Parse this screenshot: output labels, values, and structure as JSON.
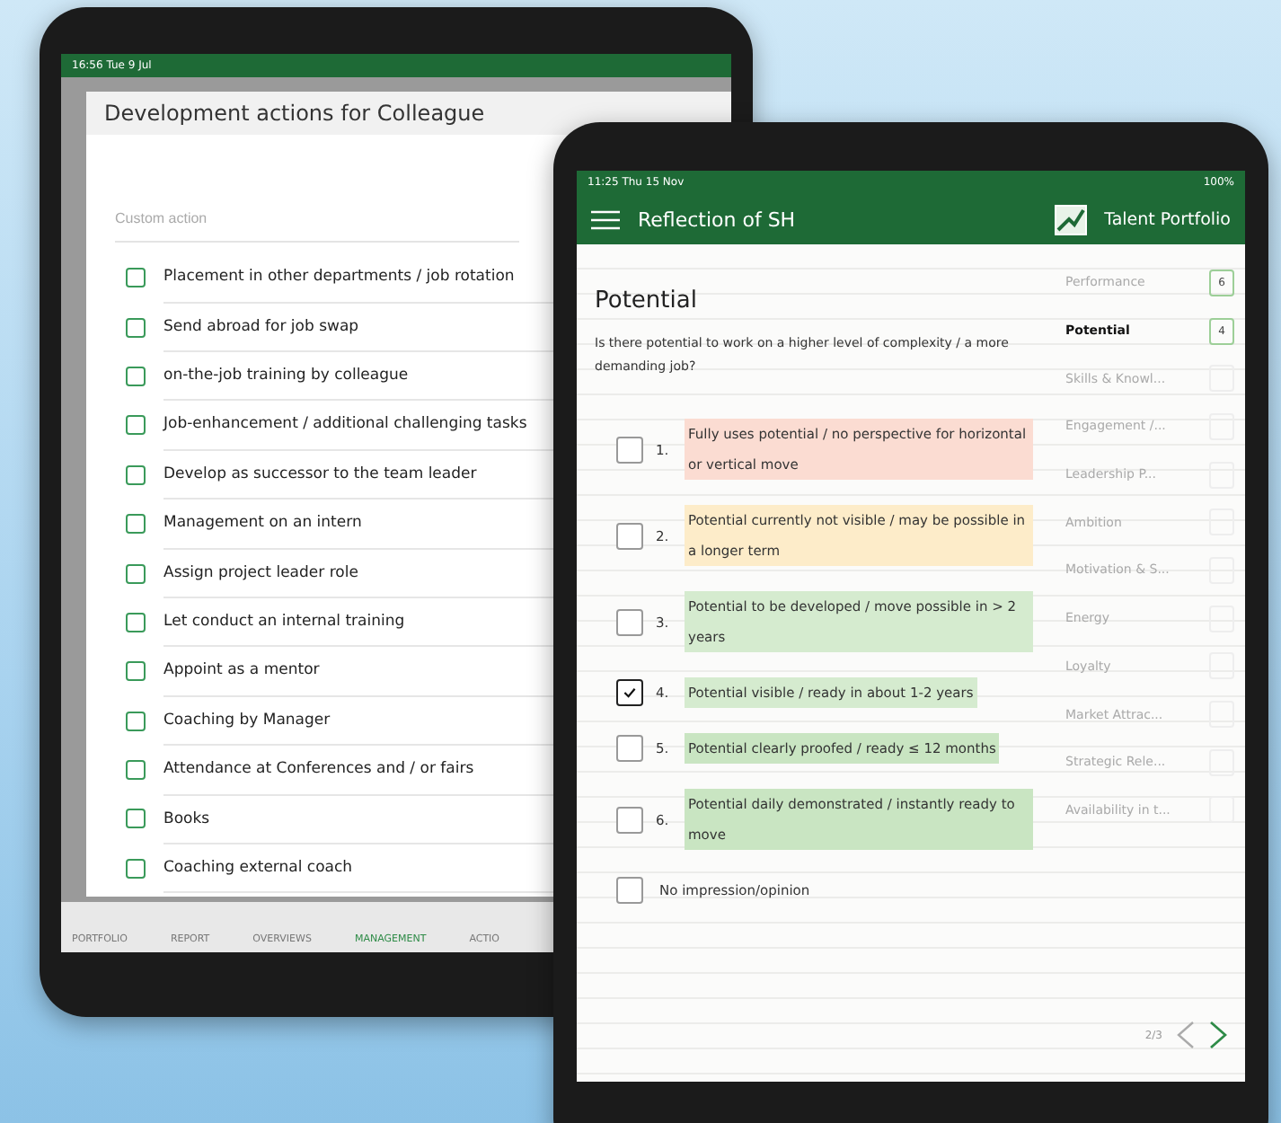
{
  "back_tablet": {
    "status_bar": {
      "time": "16:56 Tue 9 Jul"
    },
    "dialog": {
      "title": "Development actions for Colleague",
      "custom_action": {
        "placeholder": "Custom action"
      },
      "actions": [
        {
          "label": "Placement in other departments / job rotation",
          "checked": false
        },
        {
          "label": "Send abroad for job swap",
          "checked": false
        },
        {
          "label": "on-the-job training by colleague",
          "checked": false
        },
        {
          "label": "Job-enhancement / additional challenging tasks",
          "checked": false
        },
        {
          "label": "Develop as successor to the team leader",
          "checked": false
        },
        {
          "label": "Management on an intern",
          "checked": false
        },
        {
          "label": "Assign project leader role",
          "checked": false
        },
        {
          "label": "Let conduct an internal training",
          "checked": false
        },
        {
          "label": "Appoint as a mentor",
          "checked": false
        },
        {
          "label": "Coaching by Manager",
          "checked": false
        },
        {
          "label": "Attendance at Conferences and / or fairs",
          "checked": false
        },
        {
          "label": "Books",
          "checked": false
        },
        {
          "label": "Coaching external coach",
          "checked": false
        }
      ]
    },
    "tab_bar": [
      {
        "label": "PORTFOLIO",
        "selected": false
      },
      {
        "label": "REPORT",
        "selected": false
      },
      {
        "label": "OVERVIEWS",
        "selected": false
      },
      {
        "label": "MANAGEMENT",
        "selected": true
      },
      {
        "label": "ACTIO",
        "selected": false
      }
    ]
  },
  "front_tablet": {
    "status_bar": {
      "time": "11:25 Thu 15 Nov",
      "battery": "100%"
    },
    "header": {
      "title": "Reflection of SH",
      "brand": "Talent Portfolio"
    },
    "question": {
      "title": "Potential",
      "text": "Is there potential to work on a higher level of complexity / a more demanding job?"
    },
    "options": [
      {
        "number": "1.",
        "label": "Fully uses potential / no perspective for horizontal or vertical move",
        "checked": false,
        "color": "#fbdcd2"
      },
      {
        "number": "2.",
        "label": "Potential currently not visible / may be possible in a longer term",
        "checked": false,
        "color": "#fdecc9"
      },
      {
        "number": "3.",
        "label": "Potential to be developed / move possible in > 2 years",
        "checked": false,
        "color": "#d5ebcf"
      },
      {
        "number": "4.",
        "label": "Potential visible / ready in about 1-2 years",
        "checked": true,
        "color": "#d5ebcf"
      },
      {
        "number": "5.",
        "label": "Potential clearly proofed / ready ≤ 12 months",
        "checked": false,
        "color": "#c9e5c2"
      },
      {
        "number": "6.",
        "label": "Potential daily demonstrated / instantly ready to move",
        "checked": false,
        "color": "#c9e5c2"
      },
      {
        "label": "No impression/opinion",
        "checked": false
      }
    ],
    "categories": [
      {
        "label": "Performance",
        "score": "6",
        "selected": false
      },
      {
        "label": "Potential",
        "score": "4",
        "selected": true
      },
      {
        "label": "Skills & Knowl...",
        "selected": false
      },
      {
        "label": "Engagement /...",
        "selected": false
      },
      {
        "label": "Leadership P...",
        "selected": false
      },
      {
        "label": "Ambition",
        "selected": false
      },
      {
        "label": "Motivation & S...",
        "selected": false
      },
      {
        "label": "Energy",
        "selected": false
      },
      {
        "label": "Loyalty",
        "selected": false
      },
      {
        "label": "Market Attrac...",
        "selected": false
      },
      {
        "label": "Strategic Rele...",
        "selected": false
      },
      {
        "label": "Availability in t...",
        "selected": false
      }
    ],
    "pager": "2/3"
  }
}
